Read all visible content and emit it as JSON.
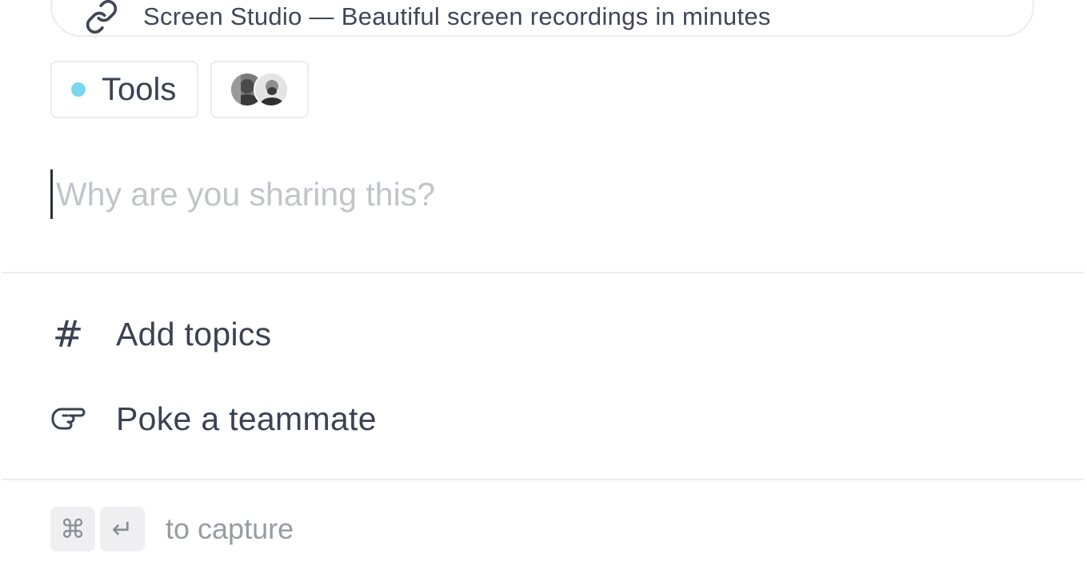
{
  "link": {
    "icon": "link-icon",
    "title": "Screen Studio — Beautiful screen recordings in minutes"
  },
  "chips": {
    "category": {
      "label": "Tools",
      "dot_color": "#7ad7f0"
    },
    "recipients": {
      "avatars": [
        "avatar-1",
        "avatar-2"
      ]
    }
  },
  "note": {
    "placeholder": "Why are you sharing this?",
    "value": ""
  },
  "actions": [
    {
      "icon": "hash-icon",
      "label": "Add topics"
    },
    {
      "icon": "pointing-hand-icon",
      "label": "Poke a teammate"
    }
  ],
  "footer": {
    "keys": [
      "⌘",
      "↵"
    ],
    "hint": "to capture"
  }
}
